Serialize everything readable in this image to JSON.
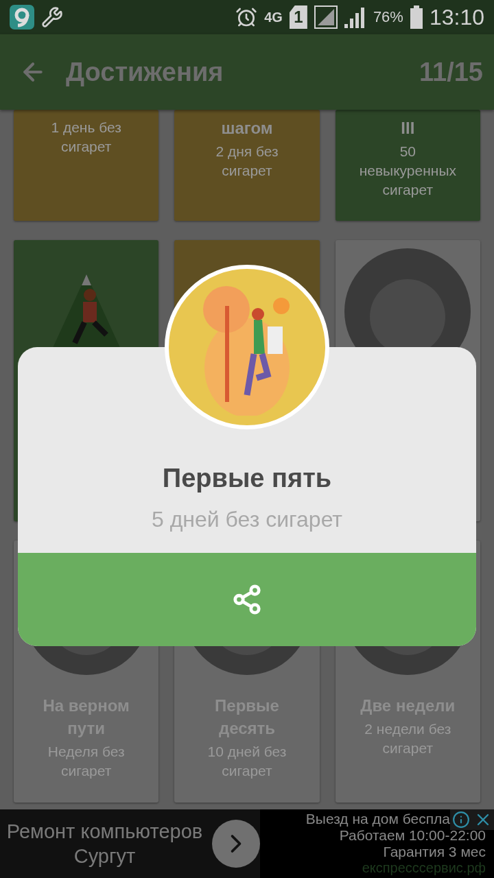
{
  "status_bar": {
    "network": "4G",
    "sim": "1",
    "battery": "76%",
    "time": "13:10"
  },
  "app_bar": {
    "title": "Достижения",
    "count": "11/15"
  },
  "rows": [
    {
      "cards": [
        {
          "kind": "text",
          "color": "#5f4f22",
          "subtitle": "1 день без сигарет"
        },
        {
          "kind": "text",
          "color": "#5f4f22",
          "title": "шагом",
          "subtitle": "2 дня без сигарет"
        },
        {
          "kind": "text",
          "color": "#2c4527",
          "title": "III",
          "subtitle": "50 невыкуренных сигарет"
        }
      ]
    },
    {
      "cards": [
        {
          "kind": "mountain",
          "color": "#2c4527"
        },
        {
          "kind": "plain",
          "color": "#5f4f22"
        },
        {
          "kind": "circle",
          "color": "#686868"
        }
      ]
    },
    {
      "cards": [
        {
          "kind": "circle",
          "color": "#686868",
          "title": "На верном пути",
          "subtitle": "Неделя без сигарет"
        },
        {
          "kind": "circle",
          "color": "#686868",
          "title": "Первые десять",
          "subtitle": "10 дней без сигарет"
        },
        {
          "kind": "circle",
          "color": "#686868",
          "title": "Две недели",
          "subtitle": "2 недели без сигарет"
        }
      ]
    }
  ],
  "dialog": {
    "title": "Первые пять",
    "subtitle": "5 дней без сигарет"
  },
  "ad": {
    "headline": "Ремонт компьютеров Сургут",
    "lines": [
      "Выезд на дом беспла",
      "Работаем 10:00-22:00",
      "Гарантия 3 мес"
    ],
    "url": "експресссервис.рф"
  }
}
